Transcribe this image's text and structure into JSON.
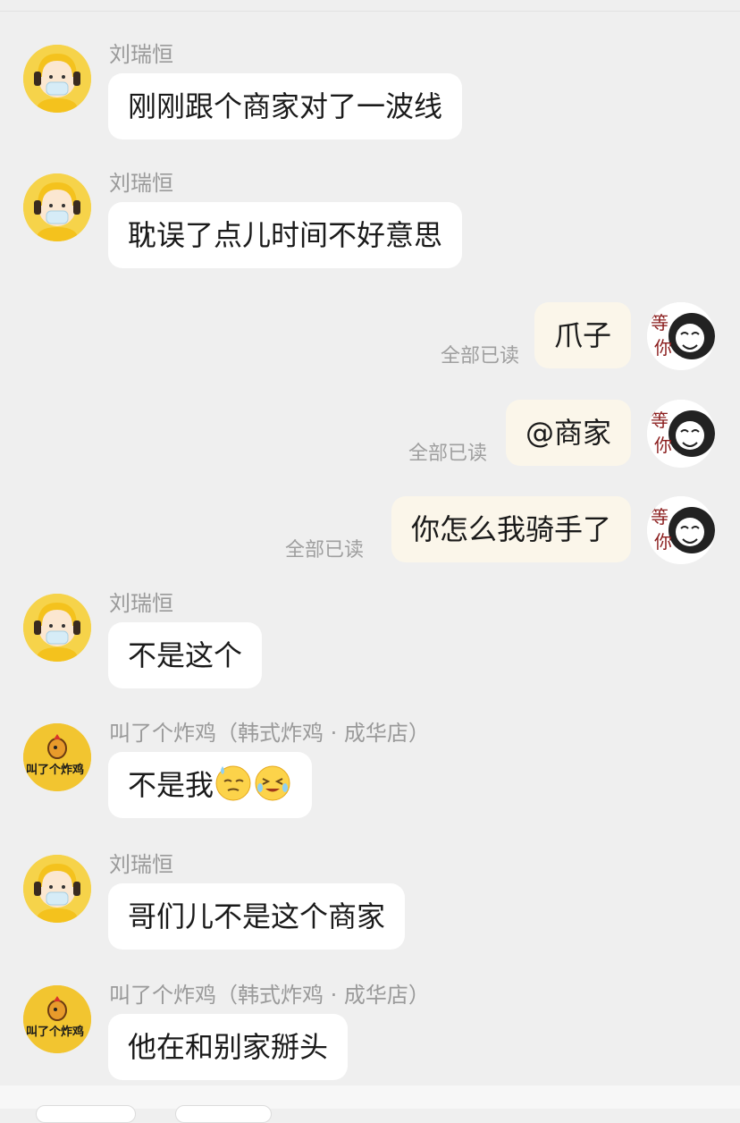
{
  "messages": [
    {
      "sender": "刘瑞恒",
      "text": "刚刚跟个商家对了一波线"
    },
    {
      "sender": "刘瑞恒",
      "text": "耽误了点儿时间不好意思"
    },
    {
      "text": "爪子",
      "read_status": "全部已读"
    },
    {
      "text": "@商家",
      "read_status": "全部已读"
    },
    {
      "text": "你怎么我骑手了",
      "read_status": "全部已读"
    },
    {
      "sender": "刘瑞恒",
      "text": "不是这个"
    },
    {
      "sender": "叫了个炸鸡（韩式炸鸡 · 成华店）",
      "text": "不是我",
      "emojis": [
        "sweat-face-emoji",
        "laughing-tears-emoji"
      ]
    },
    {
      "sender": "刘瑞恒",
      "text": "哥们儿不是这个商家"
    },
    {
      "sender": "叫了个炸鸡（韩式炸鸡 · 成华店）",
      "text": "他在和别家掰头"
    }
  ],
  "avatars": {
    "merchant_logo_text": "叫了个炸鸡",
    "self_sticker_text": "等你"
  },
  "colors": {
    "background": "#efefef",
    "incoming_bubble": "#ffffff",
    "outgoing_bubble": "#fbf6ea",
    "rider_avatar_bg": "#f6d34a",
    "merchant_avatar_bg": "#f2c530"
  }
}
